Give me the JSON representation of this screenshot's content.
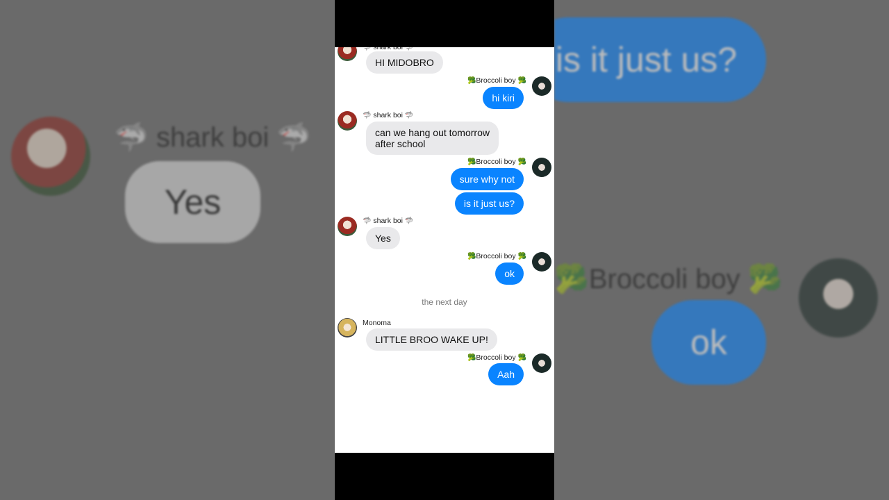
{
  "users": {
    "kiri": {
      "name": "shark boi",
      "emoji": "🦈"
    },
    "mido": {
      "name": "Broccoli boy",
      "emoji": "🥦"
    },
    "mono": {
      "name": "Monoma"
    }
  },
  "messages": [
    {
      "from": "kiri",
      "text": "HI MIDOBRO"
    },
    {
      "from": "mido",
      "text": "hi kiri"
    },
    {
      "from": "kiri",
      "text": "can we hang out tomorrow after school"
    },
    {
      "from": "mido",
      "text": "sure why not"
    },
    {
      "from": "mido",
      "text": "is it just us?"
    },
    {
      "from": "kiri",
      "text": "Yes"
    },
    {
      "from": "mido",
      "text": "ok"
    },
    {
      "from": "mono",
      "text": "LITTLE BROO WAKE UP!"
    },
    {
      "from": "mido",
      "text": "Aah"
    }
  ],
  "message_lines": {
    "m2_line1": "can we hang out tomorrow",
    "m2_line2": "after school"
  },
  "system": {
    "next_day": "the next day"
  },
  "colors": {
    "outgoing": "#0a84ff",
    "incoming": "#e9e9eb"
  }
}
